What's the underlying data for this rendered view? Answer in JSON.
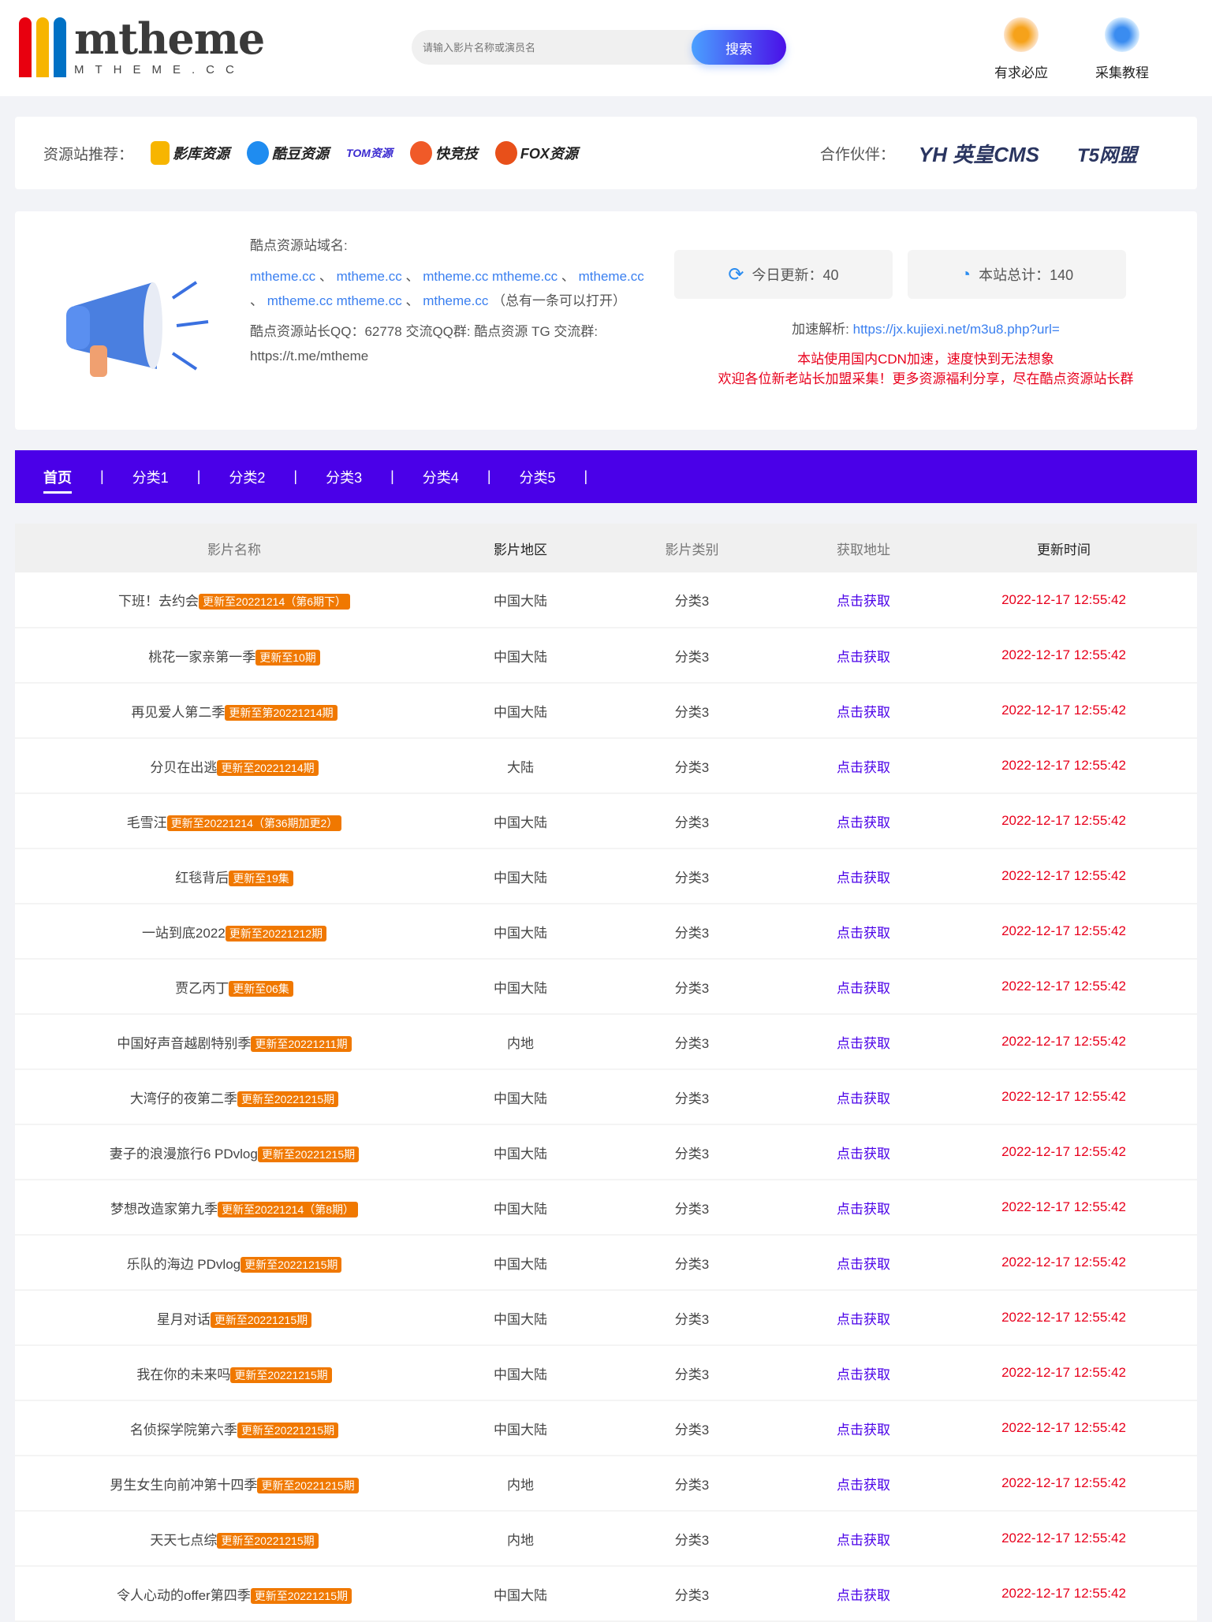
{
  "header": {
    "logo_main": "mtheme",
    "logo_sub": "MTHEME.CC",
    "search_placeholder": "请输入影片名称或演员名",
    "search_button": "搜索",
    "links": [
      {
        "label": "有求必应"
      },
      {
        "label": "采集教程"
      }
    ],
    "colors": {
      "bar1": "#e8000f",
      "bar2": "#f7b500",
      "bar3": "#0071c5"
    }
  },
  "partners": {
    "recommend_label": "资源站推荐：",
    "recommend": [
      "影库资源",
      "酷豆资源",
      "TOM资源",
      "快竞技",
      "FOX资源"
    ],
    "partner_label": "合作伙伴：",
    "partner_list": [
      "YH 英皇CMS",
      "T5网盟"
    ]
  },
  "info": {
    "domain_label": "酷点资源站域名:",
    "domains": [
      "mtheme.cc",
      "mtheme.cc",
      "mtheme.cc mtheme.cc",
      "mtheme.cc",
      "mtheme.cc mtheme.cc",
      "mtheme.cc"
    ],
    "domains_note": "（总有一条可以打开）",
    "contact": "酷点资源站长QQ：62778 交流QQ群: 酷点资源 TG 交流群: https://t.me/mtheme",
    "today_label": "今日更新：40",
    "total_label": "本站总计：140",
    "parse_label": "加速解析:",
    "parse_url": "https://jx.kujiexi.net/m3u8.php?url=",
    "notice1": "本站使用国内CDN加速，速度快到无法想象",
    "notice2": "欢迎各位新老站长加盟采集！更多资源福利分享，尽在酷点资源站长群"
  },
  "nav": [
    "首页",
    "分类1",
    "分类2",
    "分类3",
    "分类4",
    "分类5"
  ],
  "table": {
    "headers": [
      "影片名称",
      "影片地区",
      "影片类别",
      "获取地址",
      "更新时间"
    ],
    "rows": [
      {
        "name": "下班！去约会",
        "badge": "更新至20221214（第6期下）",
        "region": "中国大陆",
        "cat": "分类3",
        "link": "点击获取",
        "time": "2022-12-17 12:55:42"
      },
      {
        "name": "桃花一家亲第一季",
        "badge": "更新至10期",
        "region": "中国大陆",
        "cat": "分类3",
        "link": "点击获取",
        "time": "2022-12-17 12:55:42"
      },
      {
        "name": "再见爱人第二季",
        "badge": "更新至第20221214期",
        "region": "中国大陆",
        "cat": "分类3",
        "link": "点击获取",
        "time": "2022-12-17 12:55:42"
      },
      {
        "name": "分贝在出逃",
        "badge": "更新至20221214期",
        "region": "大陆",
        "cat": "分类3",
        "link": "点击获取",
        "time": "2022-12-17 12:55:42"
      },
      {
        "name": "毛雪汪",
        "badge": "更新至20221214（第36期加更2）",
        "region": "中国大陆",
        "cat": "分类3",
        "link": "点击获取",
        "time": "2022-12-17 12:55:42"
      },
      {
        "name": "红毯背后",
        "badge": "更新至19集",
        "region": "中国大陆",
        "cat": "分类3",
        "link": "点击获取",
        "time": "2022-12-17 12:55:42"
      },
      {
        "name": "一站到底2022",
        "badge": "更新至20221212期",
        "region": "中国大陆",
        "cat": "分类3",
        "link": "点击获取",
        "time": "2022-12-17 12:55:42"
      },
      {
        "name": "贾乙丙丁",
        "badge": "更新至06集",
        "region": "中国大陆",
        "cat": "分类3",
        "link": "点击获取",
        "time": "2022-12-17 12:55:42"
      },
      {
        "name": "中国好声音越剧特别季",
        "badge": "更新至20221211期",
        "region": "内地",
        "cat": "分类3",
        "link": "点击获取",
        "time": "2022-12-17 12:55:42"
      },
      {
        "name": "大湾仔的夜第二季",
        "badge": "更新至20221215期",
        "region": "中国大陆",
        "cat": "分类3",
        "link": "点击获取",
        "time": "2022-12-17 12:55:42"
      },
      {
        "name": "妻子的浪漫旅行6 PDvlog",
        "badge": "更新至20221215期",
        "region": "中国大陆",
        "cat": "分类3",
        "link": "点击获取",
        "time": "2022-12-17 12:55:42"
      },
      {
        "name": "梦想改造家第九季",
        "badge": "更新至20221214（第8期）",
        "region": "中国大陆",
        "cat": "分类3",
        "link": "点击获取",
        "time": "2022-12-17 12:55:42"
      },
      {
        "name": "乐队的海边 PDvlog",
        "badge": "更新至20221215期",
        "region": "中国大陆",
        "cat": "分类3",
        "link": "点击获取",
        "time": "2022-12-17 12:55:42"
      },
      {
        "name": "星月对话",
        "badge": "更新至20221215期",
        "region": "中国大陆",
        "cat": "分类3",
        "link": "点击获取",
        "time": "2022-12-17 12:55:42"
      },
      {
        "name": "我在你的未来吗",
        "badge": "更新至20221215期",
        "region": "中国大陆",
        "cat": "分类3",
        "link": "点击获取",
        "time": "2022-12-17 12:55:42"
      },
      {
        "name": "名侦探学院第六季",
        "badge": "更新至20221215期",
        "region": "中国大陆",
        "cat": "分类3",
        "link": "点击获取",
        "time": "2022-12-17 12:55:42"
      },
      {
        "name": "男生女生向前冲第十四季",
        "badge": "更新至20221215期",
        "region": "内地",
        "cat": "分类3",
        "link": "点击获取",
        "time": "2022-12-17 12:55:42"
      },
      {
        "name": "天天七点综",
        "badge": "更新至20221215期",
        "region": "内地",
        "cat": "分类3",
        "link": "点击获取",
        "time": "2022-12-17 12:55:42"
      },
      {
        "name": "令人心动的offer第四季",
        "badge": "更新至20221215期",
        "region": "中国大陆",
        "cat": "分类3",
        "link": "点击获取",
        "time": "2022-12-17 12:55:42"
      }
    ]
  }
}
